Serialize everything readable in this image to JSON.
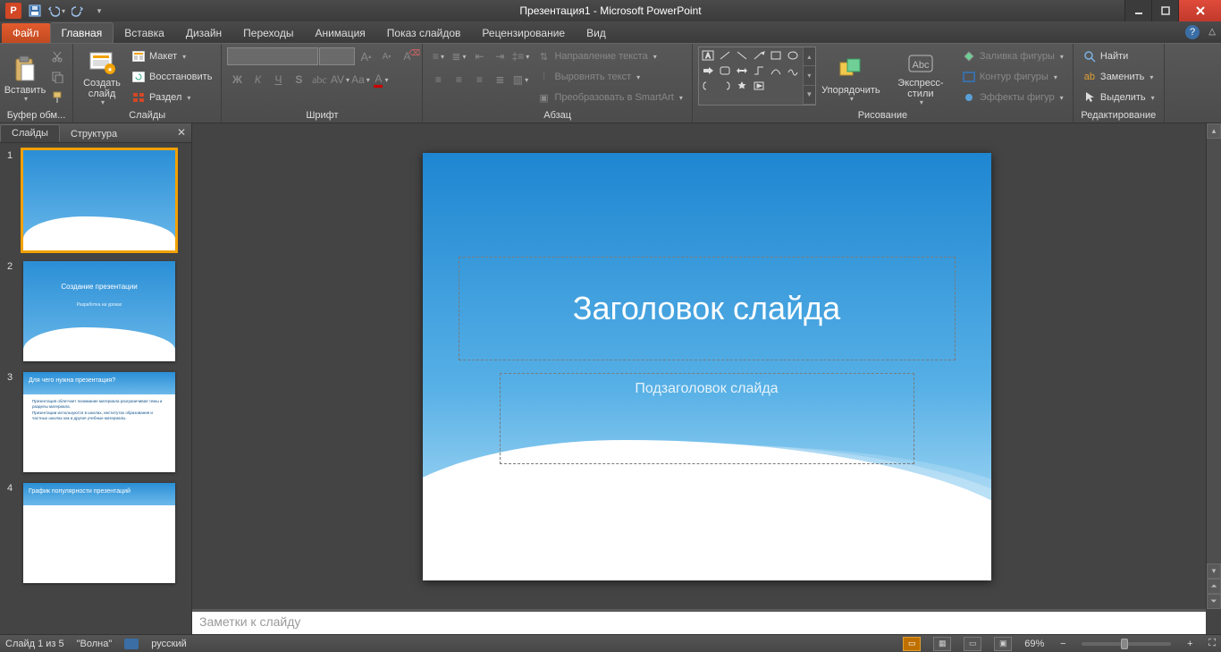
{
  "title": "Презентация1 - Microsoft PowerPoint",
  "qat": {
    "app": "P"
  },
  "tabs": {
    "file": "Файл",
    "items": [
      "Главная",
      "Вставка",
      "Дизайн",
      "Переходы",
      "Анимация",
      "Показ слайдов",
      "Рецензирование",
      "Вид"
    ],
    "active": 0
  },
  "ribbon": {
    "clipboard": {
      "label": "Буфер обм...",
      "paste": "Вставить"
    },
    "slides": {
      "label": "Слайды",
      "new": "Создать\nслайд",
      "layout": "Макет",
      "reset": "Восстановить",
      "section": "Раздел"
    },
    "font": {
      "label": "Шрифт"
    },
    "paragraph": {
      "label": "Абзац",
      "textdir": "Направление текста",
      "align": "Выровнять текст",
      "smartart": "Преобразовать в SmartArt"
    },
    "drawing": {
      "label": "Рисование",
      "arrange": "Упорядочить",
      "quick": "Экспресс-стили",
      "fill": "Заливка фигуры",
      "outline": "Контур фигуры",
      "effects": "Эффекты фигур"
    },
    "editing": {
      "label": "Редактирование",
      "find": "Найти",
      "replace": "Заменить",
      "select": "Выделить"
    }
  },
  "side": {
    "tab_slides": "Слайды",
    "tab_outline": "Структура"
  },
  "thumbs": [
    {
      "n": "1",
      "title": "",
      "sub": ""
    },
    {
      "n": "2",
      "title": "Создание презентации",
      "sub": "Разработка на уроках"
    },
    {
      "n": "3",
      "head": "Для чего нужна презентация?",
      "body": "Презентация облегчает понимание материала разграничивая темы и разделы материала.\nПрезентации используются в школах, институтах образования и частных школах как и другие учебные материалы."
    },
    {
      "n": "4",
      "head": "График популярности презентаций"
    }
  ],
  "slide": {
    "title": "Заголовок слайда",
    "subtitle": "Подзаголовок слайда"
  },
  "notes": {
    "placeholder": "Заметки к слайду"
  },
  "status": {
    "slide": "Слайд 1 из 5",
    "theme": "\"Волна\"",
    "lang": "русский",
    "zoom": "69%"
  }
}
